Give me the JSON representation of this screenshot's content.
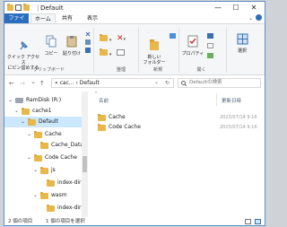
{
  "window": {
    "title": "Default",
    "title_sep": "|",
    "controls": {
      "minimize": "—",
      "maximize": "☐",
      "close": "✕"
    }
  },
  "ribbon_tabs": [
    "ファイル",
    "ホーム",
    "共有",
    "表示"
  ],
  "ribbon": {
    "clipboard": {
      "quick_access": "クイック アクセス\nにピン留めする",
      "copy": "コピー",
      "paste": "貼り付け",
      "group": "クリップボード"
    },
    "organize": {
      "group": "整理"
    },
    "new": {
      "new_folder": "新しい\nフォルダー",
      "group": "新規"
    },
    "open": {
      "properties": "プロパティ",
      "group": "開く"
    },
    "select": {
      "select": "選択"
    }
  },
  "address": {
    "back": "←",
    "forward": "→",
    "dropdown": "⌄",
    "up": "↑",
    "path": "« cac... › Default",
    "path_dropdown": "⌄",
    "refresh": "↻",
    "search_placeholder": "Defaultの検索"
  },
  "tree": [
    {
      "label": "RamDisk (R:)",
      "expanded": true
    },
    {
      "label": "cache1",
      "expanded": true
    },
    {
      "label": "Default",
      "expanded": true,
      "selected": true
    },
    {
      "label": "Cache",
      "expanded": true
    },
    {
      "label": "Cache_Data",
      "expanded": false
    },
    {
      "label": "Code Cache",
      "expanded": true
    },
    {
      "label": "js",
      "expanded": true
    },
    {
      "label": "index-dir",
      "expanded": false
    },
    {
      "label": "wasm",
      "expanded": true
    },
    {
      "label": "index-dir",
      "expanded": false
    }
  ],
  "columns": {
    "name": "名前",
    "modified": "更新日時"
  },
  "files": [
    {
      "name": "Cache",
      "modified": "2023/07/14 9:16"
    },
    {
      "name": "Code Cache",
      "modified": "2023/07/14 9:16"
    }
  ],
  "status": {
    "count": "2 個の項目",
    "selected": "1 個の項目を選択"
  }
}
